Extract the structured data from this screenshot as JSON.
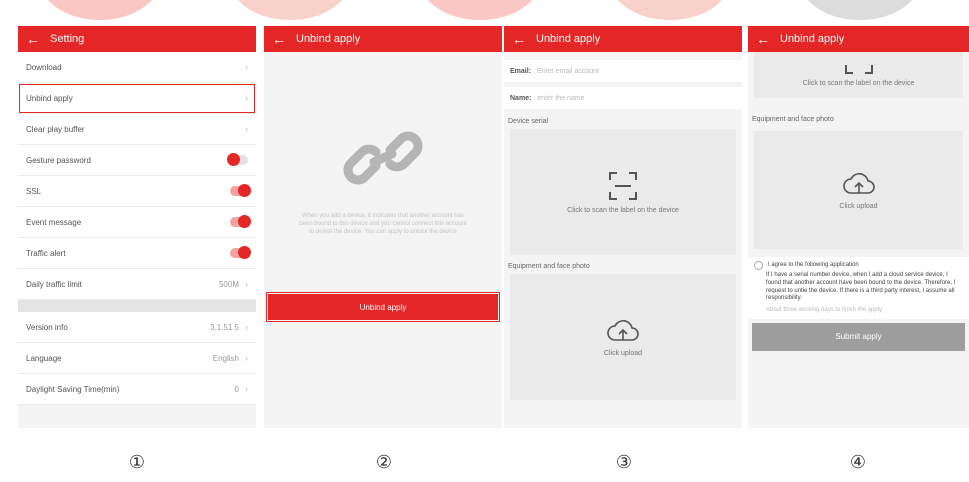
{
  "colors": {
    "accent": "#e52626",
    "screen_bg": "#f4f4f4",
    "card_bg": "#eaeaea",
    "disabled": "#9e9e9e"
  },
  "screen1": {
    "title": "Setting",
    "items": [
      {
        "label": "Download",
        "value": "",
        "control": "chevron"
      },
      {
        "label": "Unbind apply",
        "value": "",
        "control": "chevron",
        "highlighted": true
      },
      {
        "label": "Clear play buffer",
        "value": "",
        "control": "chevron"
      },
      {
        "label": "Gesture password",
        "value": "",
        "control": "toggle-off"
      },
      {
        "label": "SSL",
        "value": "",
        "control": "toggle-on"
      },
      {
        "label": "Event message",
        "value": "",
        "control": "toggle-on"
      },
      {
        "label": "Traffic alert",
        "value": "",
        "control": "toggle-on"
      },
      {
        "label": "Daily traffic limit",
        "value": "500M",
        "control": "chevron"
      }
    ],
    "items2": [
      {
        "label": "Version info",
        "value": "3.1.51.5",
        "control": "chevron"
      },
      {
        "label": "Language",
        "value": "English",
        "control": "chevron"
      },
      {
        "label": "Daylight Saving Time(min)",
        "value": "0",
        "control": "chevron"
      }
    ]
  },
  "screen2": {
    "title": "Unbind apply",
    "description": "When you add a device, it indicates that another account has been bound to this device and you cannot connect this account to delete the device. You can apply to unlock the device",
    "button": "Unbind apply"
  },
  "screen3": {
    "title": "Unbind apply",
    "email_label": "Email:",
    "email_placeholder": "Enter email account",
    "name_label": "Name:",
    "name_placeholder": "enter the name",
    "serial_section": "Device serial",
    "scan_text": "Click to scan the label on the device",
    "photo_section": "Equipment and face photo",
    "upload_text": "Click upload"
  },
  "screen4": {
    "title": "Unbind apply",
    "scan_text": "Click to scan the label on the device",
    "photo_section": "Equipment and face photo",
    "upload_text": "Click upload",
    "agree_label": "I agree to the following application",
    "agreement": "If I have a serial number device, when I add a cloud service device, I found that another account have been bound to the device. Therefore, I request to untie the device. If there is a third party interest, I assume all responsibility.",
    "note": "About three working days to finish the apply",
    "submit": "Submit apply"
  },
  "step_numbers": [
    "①",
    "②",
    "③",
    "④"
  ]
}
